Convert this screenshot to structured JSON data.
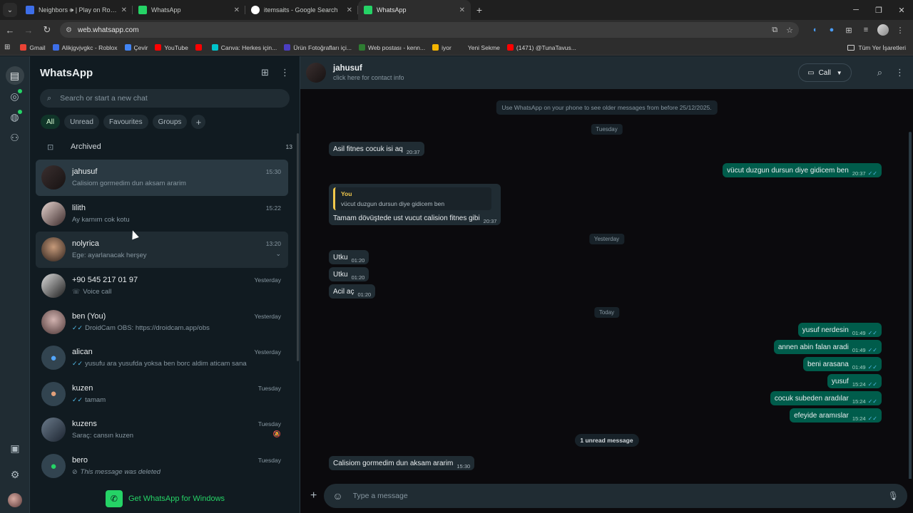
{
  "browser": {
    "tabs": [
      {
        "title": "Neighbors 🕪 | Play on Roblox",
        "color": "#3d6ee8",
        "active": false
      },
      {
        "title": "WhatsApp",
        "color": "#25d366",
        "active": false
      },
      {
        "title": "itemsaits - Google Search",
        "color": "#ffffff",
        "active": false
      },
      {
        "title": "WhatsApp",
        "color": "#25d366",
        "active": true
      }
    ],
    "url": "web.whatsapp.com",
    "bookmarks": [
      {
        "label": "Gmail",
        "color": "#ea4335"
      },
      {
        "label": "Alikjgvjvgkc - Roblox",
        "color": "#3d6ee8"
      },
      {
        "label": "Çevir",
        "color": "#4285f4"
      },
      {
        "label": "YouTube",
        "color": "#ff0000"
      },
      {
        "label": "",
        "color": "#ff0000"
      },
      {
        "label": "Canva: Herkes için...",
        "color": "#00c4cc"
      },
      {
        "label": "Ürün Fotoğrafları içi...",
        "color": "#4b3ec2"
      },
      {
        "label": "Web postası - kenn...",
        "color": "#2e7d32"
      },
      {
        "label": "iyor",
        "color": "#f4b400"
      },
      {
        "label": "Yeni Sekme",
        "color": "#2d2d2d"
      },
      {
        "label": "(1471) @TunaTavus...",
        "color": "#ff0000"
      }
    ],
    "bookmarks_folder": "Tüm Yer İşaretleri"
  },
  "sidebar": {
    "title": "WhatsApp",
    "search_placeholder": "Search or start a new chat",
    "filters": [
      "All",
      "Unread",
      "Favourites",
      "Groups"
    ],
    "archived_label": "Archived",
    "archived_count": "13",
    "chats": [
      {
        "name": "jahusuf",
        "time": "15:30",
        "preview": "Calisiom gormedim dun aksam ararim",
        "ticks": false,
        "selected": true,
        "avatar": "linear-gradient(135deg,#3a2f2f,#171212)"
      },
      {
        "name": "lilith",
        "time": "15:22",
        "preview": "Ay karnım cok kotu",
        "ticks": false,
        "avatar": "linear-gradient(135deg,#e7d5d0,#3b2a2a)"
      },
      {
        "name": "nolyrica",
        "time": "13:20",
        "preview": "Ege: ayarlanacak herşey",
        "ticks": false,
        "hover": true,
        "avatar": "radial-gradient(circle at 50% 40%,#c69a7a,#2b1f1a)"
      },
      {
        "name": "+90 545 217 01 97",
        "time": "Yesterday",
        "preview": "Voice call",
        "call": true,
        "avatar": "linear-gradient(135deg,#dcdcdc,#1c1c1c)"
      },
      {
        "name": "ben (You)",
        "time": "Yesterday",
        "preview": "DroidCam OBS: https://droidcam.app/obs",
        "ticks": true,
        "avatar": "radial-gradient(circle at 50% 40%,#d2b3b0,#4b3535)"
      },
      {
        "name": "alican",
        "time": "Yesterday",
        "preview": "yusufu ara yusufda yoksa ben borc aldim aticam sana",
        "ticks": true,
        "default": true,
        "deficon": "#53a6fd"
      },
      {
        "name": "kuzen",
        "time": "Tuesday",
        "preview": "tamam",
        "ticks": true,
        "default": true,
        "deficon": "#e2a07a"
      },
      {
        "name": "kuzens",
        "time": "Tuesday",
        "preview": "Saraç: cansın kuzen",
        "ticks": false,
        "muted": true,
        "avatar": "linear-gradient(135deg,#6a7a8a,#1c2430)"
      },
      {
        "name": "bero",
        "time": "Tuesday",
        "preview": "This message was deleted",
        "deleted": true,
        "default": true,
        "deficon": "#25d366"
      }
    ],
    "get_app_label": "Get WhatsApp for Windows"
  },
  "conversation": {
    "contact_name": "jahusuf",
    "contact_sub": "click here for contact info",
    "call_label": "Call",
    "system_notice": "Use WhatsApp on your phone to see older messages from before 25/12/2025.",
    "days": [
      "Tuesday",
      "Yesterday",
      "Today"
    ],
    "messages": [
      {
        "dir": "in",
        "text": "Asil fitnes cocuk isi aq",
        "time": "20:37"
      },
      {
        "dir": "out",
        "text": "vücut duzgun dursun diye gidicem ben",
        "time": "20:37"
      },
      {
        "dir": "in",
        "quote_author": "You",
        "quote_text": "vücut duzgun dursun diye gidicem ben",
        "text": "Tamam dövüştede ust vucut calision fitnes gibi",
        "time": "20:37"
      },
      {
        "dir": "in",
        "text": "Utku",
        "time": "01:20"
      },
      {
        "dir": "in",
        "text": "Utku",
        "time": "01:20"
      },
      {
        "dir": "in",
        "text": "Acil aç",
        "time": "01:20"
      },
      {
        "dir": "out",
        "text": "yusuf nerdesin",
        "time": "01:49"
      },
      {
        "dir": "out",
        "text": "annen abin falan aradi",
        "time": "01:49"
      },
      {
        "dir": "out",
        "text": "beni arasana",
        "time": "01:49"
      },
      {
        "dir": "out",
        "text": "yusuf",
        "time": "15:24"
      },
      {
        "dir": "out",
        "text": "cocuk subeden aradılar",
        "time": "15:24"
      },
      {
        "dir": "out",
        "text": "efeyide aramıslar",
        "time": "15:24"
      },
      {
        "dir": "in",
        "text": "Calisiom gormedim dun aksam ararim",
        "time": "15:30"
      }
    ],
    "unread_label": "1 unread message",
    "composer_placeholder": "Type a message"
  }
}
